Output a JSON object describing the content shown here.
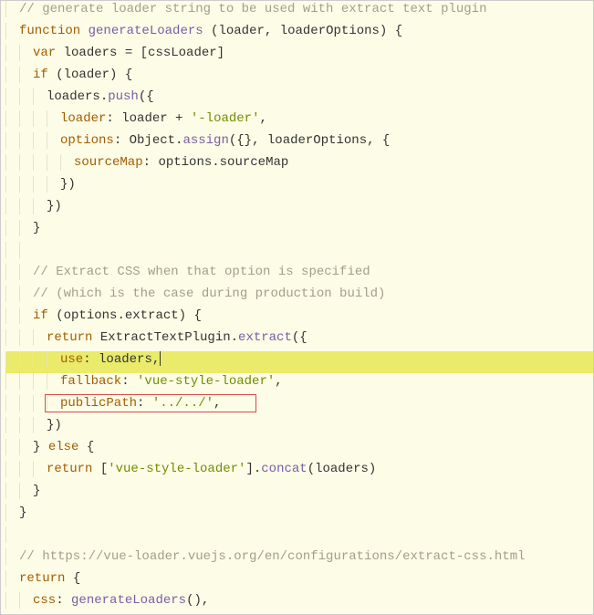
{
  "code": {
    "lines": [
      {
        "tokens": [
          {
            "cls": "tok-comment",
            "t": "// generate loader string to be used with extract text plugin"
          }
        ],
        "indent": 1
      },
      {
        "tokens": [
          {
            "cls": "tok-keyword",
            "t": "function "
          },
          {
            "cls": "tok-fn",
            "t": "generateLoaders"
          },
          {
            "cls": "tok-punc",
            "t": " ("
          },
          {
            "cls": "tok-ident",
            "t": "loader"
          },
          {
            "cls": "tok-punc",
            "t": ", "
          },
          {
            "cls": "tok-ident",
            "t": "loaderOptions"
          },
          {
            "cls": "tok-punc",
            "t": ") {"
          }
        ],
        "indent": 1
      },
      {
        "tokens": [
          {
            "cls": "tok-keyword",
            "t": "var "
          },
          {
            "cls": "tok-ident",
            "t": "loaders "
          },
          {
            "cls": "tok-punc",
            "t": "= ["
          },
          {
            "cls": "tok-ident",
            "t": "cssLoader"
          },
          {
            "cls": "tok-punc",
            "t": "]"
          }
        ],
        "indent": 2
      },
      {
        "tokens": [
          {
            "cls": "tok-keyword",
            "t": "if "
          },
          {
            "cls": "tok-punc",
            "t": "("
          },
          {
            "cls": "tok-ident",
            "t": "loader"
          },
          {
            "cls": "tok-punc",
            "t": ") {"
          }
        ],
        "indent": 2
      },
      {
        "tokens": [
          {
            "cls": "tok-ident",
            "t": "loaders"
          },
          {
            "cls": "tok-punc",
            "t": "."
          },
          {
            "cls": "tok-fn",
            "t": "push"
          },
          {
            "cls": "tok-punc",
            "t": "({"
          }
        ],
        "indent": 3
      },
      {
        "tokens": [
          {
            "cls": "tok-property",
            "t": "loader"
          },
          {
            "cls": "tok-punc",
            "t": ": "
          },
          {
            "cls": "tok-ident",
            "t": "loader "
          },
          {
            "cls": "tok-punc",
            "t": "+ "
          },
          {
            "cls": "tok-string",
            "t": "'-loader'"
          },
          {
            "cls": "tok-punc",
            "t": ","
          }
        ],
        "indent": 4
      },
      {
        "tokens": [
          {
            "cls": "tok-property",
            "t": "options"
          },
          {
            "cls": "tok-punc",
            "t": ": "
          },
          {
            "cls": "tok-ident",
            "t": "Object"
          },
          {
            "cls": "tok-punc",
            "t": "."
          },
          {
            "cls": "tok-fn",
            "t": "assign"
          },
          {
            "cls": "tok-punc",
            "t": "({}, "
          },
          {
            "cls": "tok-ident",
            "t": "loaderOptions"
          },
          {
            "cls": "tok-punc",
            "t": ", {"
          }
        ],
        "indent": 4
      },
      {
        "tokens": [
          {
            "cls": "tok-property",
            "t": "sourceMap"
          },
          {
            "cls": "tok-punc",
            "t": ": "
          },
          {
            "cls": "tok-ident",
            "t": "options"
          },
          {
            "cls": "tok-punc",
            "t": "."
          },
          {
            "cls": "tok-ident",
            "t": "sourceMap"
          }
        ],
        "indent": 5
      },
      {
        "tokens": [
          {
            "cls": "tok-punc",
            "t": "})"
          }
        ],
        "indent": 4
      },
      {
        "tokens": [
          {
            "cls": "tok-punc",
            "t": "})"
          }
        ],
        "indent": 3
      },
      {
        "tokens": [
          {
            "cls": "tok-punc",
            "t": "}"
          }
        ],
        "indent": 2
      },
      {
        "tokens": [],
        "indent": 2
      },
      {
        "tokens": [
          {
            "cls": "tok-comment",
            "t": "// Extract CSS when that option is specified"
          }
        ],
        "indent": 2
      },
      {
        "tokens": [
          {
            "cls": "tok-comment",
            "t": "// (which is the case during production build)"
          }
        ],
        "indent": 2
      },
      {
        "tokens": [
          {
            "cls": "tok-keyword",
            "t": "if "
          },
          {
            "cls": "tok-punc",
            "t": "("
          },
          {
            "cls": "tok-ident",
            "t": "options"
          },
          {
            "cls": "tok-punc",
            "t": "."
          },
          {
            "cls": "tok-ident",
            "t": "extract"
          },
          {
            "cls": "tok-punc",
            "t": ") {"
          }
        ],
        "indent": 2
      },
      {
        "tokens": [
          {
            "cls": "tok-keyword",
            "t": "return "
          },
          {
            "cls": "tok-ident",
            "t": "ExtractTextPlugin"
          },
          {
            "cls": "tok-punc",
            "t": "."
          },
          {
            "cls": "tok-fn",
            "t": "extract"
          },
          {
            "cls": "tok-punc",
            "t": "({"
          }
        ],
        "indent": 3
      },
      {
        "tokens": [
          {
            "cls": "tok-property",
            "t": "use"
          },
          {
            "cls": "tok-punc",
            "t": ": "
          },
          {
            "cls": "tok-ident",
            "t": "loaders"
          },
          {
            "cls": "tok-punc",
            "t": ","
          }
        ],
        "indent": 4,
        "highlight": true,
        "cursorAfter": true
      },
      {
        "tokens": [
          {
            "cls": "tok-property",
            "t": "fallback"
          },
          {
            "cls": "tok-punc",
            "t": ": "
          },
          {
            "cls": "tok-string",
            "t": "'vue-style-loader'"
          },
          {
            "cls": "tok-punc",
            "t": ","
          }
        ],
        "indent": 4
      },
      {
        "tokens": [
          {
            "cls": "tok-property",
            "t": "publicPath"
          },
          {
            "cls": "tok-punc",
            "t": ": "
          },
          {
            "cls": "tok-string",
            "t": "'../../'"
          },
          {
            "cls": "tok-punc",
            "t": ","
          }
        ],
        "indent": 4,
        "redbox": true
      },
      {
        "tokens": [
          {
            "cls": "tok-punc",
            "t": "})"
          }
        ],
        "indent": 3
      },
      {
        "tokens": [
          {
            "cls": "tok-punc",
            "t": "} "
          },
          {
            "cls": "tok-keyword",
            "t": "else "
          },
          {
            "cls": "tok-punc",
            "t": "{"
          }
        ],
        "indent": 2
      },
      {
        "tokens": [
          {
            "cls": "tok-keyword",
            "t": "return "
          },
          {
            "cls": "tok-punc",
            "t": "["
          },
          {
            "cls": "tok-string",
            "t": "'vue-style-loader'"
          },
          {
            "cls": "tok-punc",
            "t": "]."
          },
          {
            "cls": "tok-fn",
            "t": "concat"
          },
          {
            "cls": "tok-punc",
            "t": "("
          },
          {
            "cls": "tok-ident",
            "t": "loaders"
          },
          {
            "cls": "tok-punc",
            "t": ")"
          }
        ],
        "indent": 3
      },
      {
        "tokens": [
          {
            "cls": "tok-punc",
            "t": "}"
          }
        ],
        "indent": 2
      },
      {
        "tokens": [
          {
            "cls": "tok-punc",
            "t": "}"
          }
        ],
        "indent": 1
      },
      {
        "tokens": [],
        "indent": 1
      },
      {
        "tokens": [
          {
            "cls": "tok-comment",
            "t": "// https://vue-loader.vuejs.org/en/configurations/extract-css.html"
          }
        ],
        "indent": 1
      },
      {
        "tokens": [
          {
            "cls": "tok-keyword",
            "t": "return "
          },
          {
            "cls": "tok-punc",
            "t": "{"
          }
        ],
        "indent": 1
      },
      {
        "tokens": [
          {
            "cls": "tok-property",
            "t": "css"
          },
          {
            "cls": "tok-punc",
            "t": ": "
          },
          {
            "cls": "tok-fn",
            "t": "generateLoaders"
          },
          {
            "cls": "tok-punc",
            "t": "(),"
          }
        ],
        "indent": 2
      }
    ]
  }
}
